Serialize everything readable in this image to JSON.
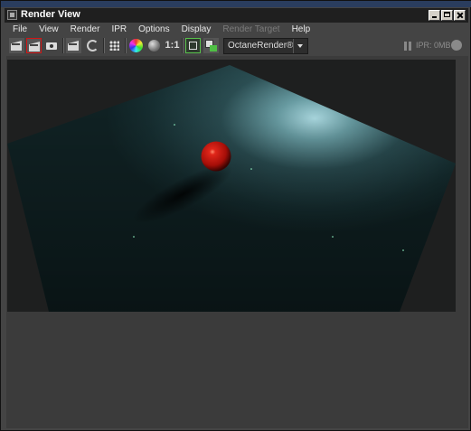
{
  "window": {
    "title": "Render View"
  },
  "menu": [
    {
      "label": "File",
      "enabled": true
    },
    {
      "label": "View",
      "enabled": true
    },
    {
      "label": "Render",
      "enabled": true
    },
    {
      "label": "IPR",
      "enabled": true
    },
    {
      "label": "Options",
      "enabled": true
    },
    {
      "label": "Display",
      "enabled": true
    },
    {
      "label": "Render Target",
      "enabled": false
    },
    {
      "label": "Help",
      "enabled": true
    }
  ],
  "toolbar": {
    "ratio_label": "1:1",
    "renderer": {
      "selected": "OctaneRender®"
    },
    "ipr_status": "IPR: 0MB"
  },
  "colors": {
    "highlight_red": "#d21414",
    "highlight_green": "#58c14b",
    "sphere": "#c0140c",
    "floor": "#13292b",
    "light": "#b8eaf2"
  }
}
